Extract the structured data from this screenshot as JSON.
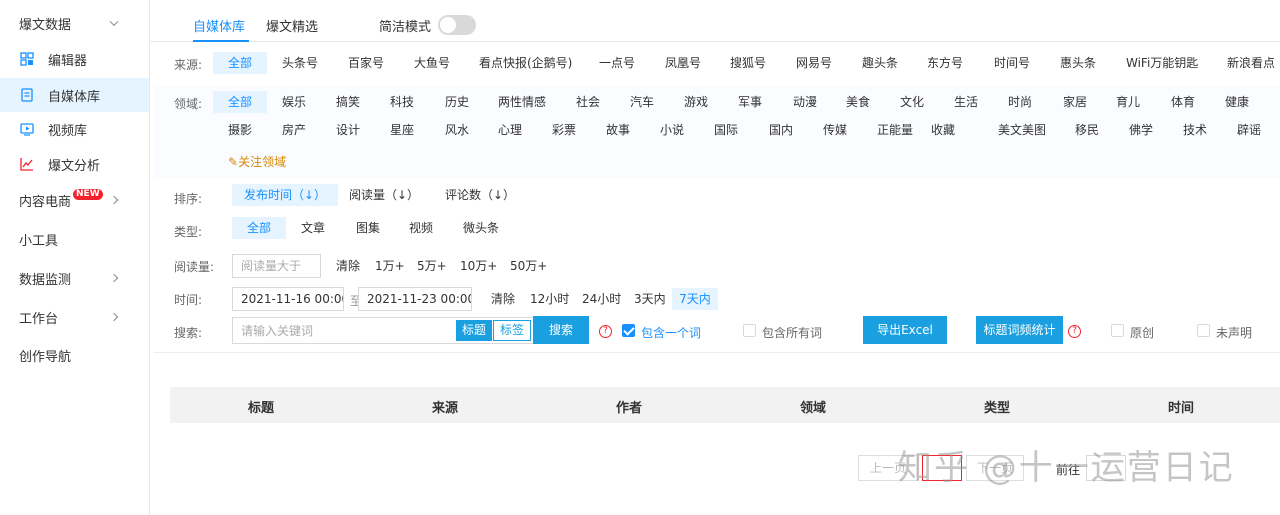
{
  "sidebar": {
    "top_menu": "爆文数据",
    "items": [
      {
        "label": "编辑器",
        "icon": "grid-icon"
      },
      {
        "label": "自媒体库",
        "icon": "document-icon"
      },
      {
        "label": "视频库",
        "icon": "video-icon"
      },
      {
        "label": "爆文分析",
        "icon": "chart-icon"
      }
    ],
    "content_ecommerce": "内容电商",
    "new_badge": "NEW",
    "tools": "小工具",
    "data_monitor": "数据监测",
    "workbench": "工作台",
    "creation_nav": "创作导航"
  },
  "tabs": {
    "media_library": "自媒体库",
    "selected_articles": "爆文精选",
    "simple_mode": "简洁模式"
  },
  "filters": {
    "source_label": "来源:",
    "sources": [
      "全部",
      "头条号",
      "百家号",
      "大鱼号",
      "看点快报(企鹅号)",
      "一点号",
      "凤凰号",
      "搜狐号",
      "网易号",
      "趣头条",
      "东方号",
      "时间号",
      "惠头条",
      "WiFi万能钥匙",
      "新浪看点"
    ],
    "field_label": "领域:",
    "fields_row1": [
      "全部",
      "娱乐",
      "搞笑",
      "科技",
      "历史",
      "两性情感",
      "社会",
      "汽车",
      "游戏",
      "军事",
      "动漫",
      "美食",
      "文化",
      "生活",
      "时尚",
      "家居",
      "育儿",
      "体育",
      "健康"
    ],
    "fields_row2": [
      "摄影",
      "房产",
      "设计",
      "星座",
      "风水",
      "心理",
      "彩票",
      "故事",
      "小说",
      "国际",
      "国内",
      "传媒",
      "正能量",
      "收藏",
      "美文美图",
      "移民",
      "佛学",
      "技术",
      "辟谣"
    ],
    "follow_field": "关注领域",
    "sort_label": "排序:",
    "sorts": [
      "发布时间（↓）",
      "阅读量（↓）",
      "评论数（↓）"
    ],
    "type_label": "类型:",
    "types": [
      "全部",
      "文章",
      "图集",
      "视频",
      "微头条"
    ],
    "reads_label": "阅读量:",
    "reads_placeholder": "阅读量大于",
    "reads_options": [
      "清除",
      "1万+",
      "5万+",
      "10万+",
      "50万+"
    ],
    "time_label": "时间:",
    "time_start": "2021-11-16 00:00",
    "time_to": "至",
    "time_end": "2021-11-23 00:00",
    "time_options": [
      "清除",
      "12小时",
      "24小时",
      "3天内",
      "7天内"
    ],
    "search_label": "搜索:",
    "search_placeholder": "请输入关键词",
    "search_title": "标题",
    "search_tag": "标签",
    "search_button": "搜索",
    "qmark": "?",
    "contains_one": "包含一个词",
    "contains_all": "包含所有词",
    "export_excel": "导出Excel",
    "title_word_stats": "标题词频统计",
    "original": "原创",
    "undeclared": "未声明"
  },
  "table": {
    "headers": [
      "标题",
      "来源",
      "作者",
      "领域",
      "类型",
      "时间"
    ]
  },
  "pager": {
    "prev": "上一页",
    "next": "下一页",
    "goto": "前往"
  },
  "watermark": "知乎 @十一运营日记",
  "colors": {
    "accent": "#1890ff",
    "button": "#1aa0e0",
    "badge": "#f5222d"
  }
}
